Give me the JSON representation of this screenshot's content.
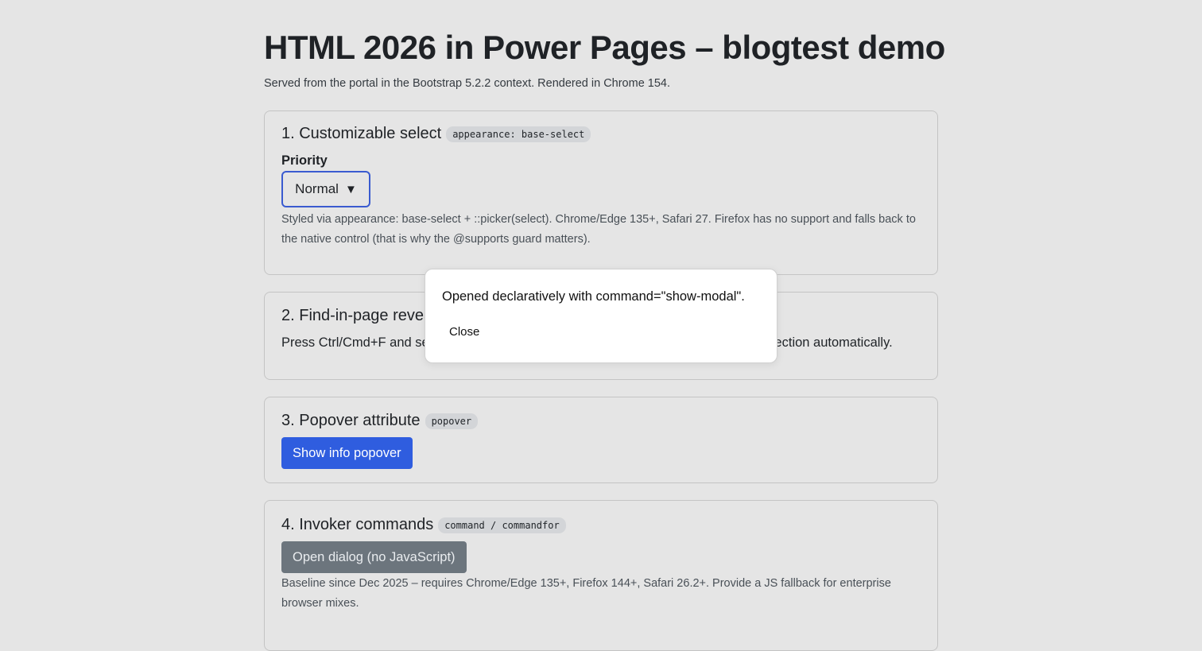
{
  "header": {
    "title": "HTML 2026 in Power Pages – blogtest demo",
    "subtitle": "Served from the portal in the Bootstrap 5.2.2 context. Rendered in Chrome 154."
  },
  "cards": [
    {
      "title": "1. Customizable select",
      "code": "appearance: base-select",
      "field_label": "Priority",
      "select_value": "Normal",
      "select_caret": "▼",
      "description": "Styled via appearance: base-select + ::picker(select). Chrome/Edge 135+, Safari 27. Firefox has no support and falls back to the native control (that is why the @supports guard matters)."
    },
    {
      "title": "2. Find-in-page reveal",
      "text": "Press Ctrl/Cmd+F and search for the hidden text – the browser opens the matching section automatically."
    },
    {
      "title": "3. Popover attribute",
      "code": "popover",
      "button_label": "Show info popover"
    },
    {
      "title": "4. Invoker commands",
      "code": "command / commandfor",
      "button_label": "Open dialog (no JavaScript)",
      "description": "Baseline since Dec 2025 – requires Chrome/Edge 135+, Firefox 144+, Safari 26.2+. Provide a JS fallback for enterprise browser mixes."
    }
  ],
  "dialog": {
    "text": "Opened declaratively with command=\"show-modal\".",
    "close_label": "Close"
  }
}
